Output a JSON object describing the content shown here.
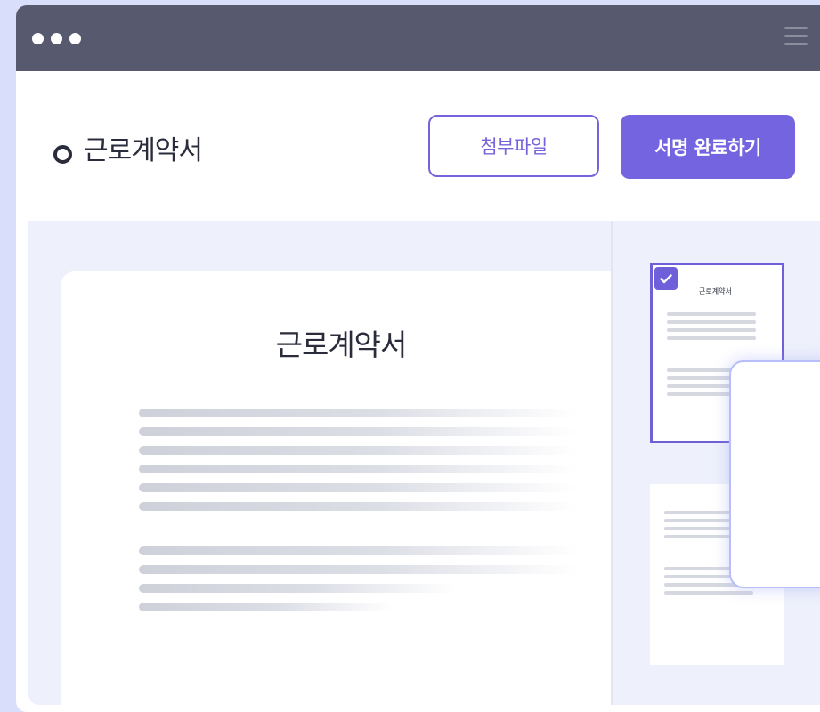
{
  "window": {
    "controls": [
      "dot",
      "dot",
      "dot"
    ],
    "menu_icon": "hamburger-menu-icon"
  },
  "header": {
    "title_icon": "circle-ring-icon",
    "title": "근로계약서",
    "attach_button": "첨부파일",
    "complete_button": "서명 완료하기"
  },
  "document": {
    "title": "근로계약서"
  },
  "thumbnails": [
    {
      "title": "근로계약서",
      "selected": true
    },
    {
      "title": "",
      "selected": false
    }
  ],
  "colors": {
    "accent": "#7464df",
    "titlebar": "#575a6e",
    "background": "#d9defa",
    "workspace": "#eef1fb"
  }
}
